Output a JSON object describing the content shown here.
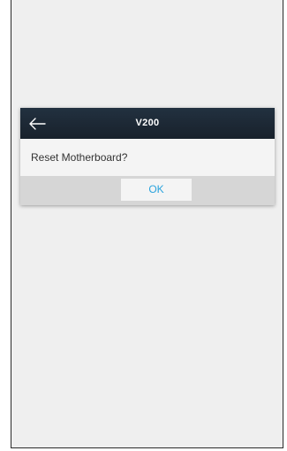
{
  "dialog": {
    "title": "V200",
    "message": "Reset Motherboard?",
    "ok_label": "OK",
    "back_icon": "arrow-left-icon"
  },
  "colors": {
    "header": "#1c2632",
    "accent": "#2aa3dd",
    "background": "#efefef"
  }
}
